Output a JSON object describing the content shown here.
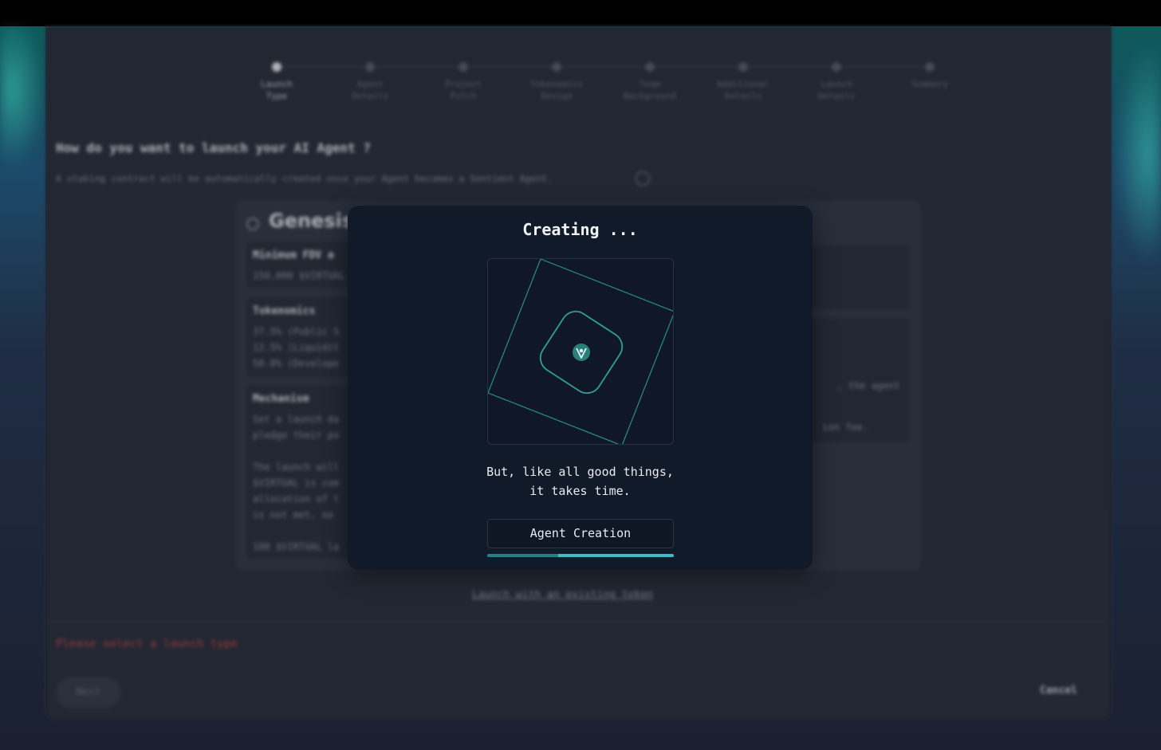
{
  "stepper": {
    "steps": [
      {
        "label": "Launch\nType",
        "active": true
      },
      {
        "label": "Agent\nDetails",
        "active": false
      },
      {
        "label": "Project\nPitch",
        "active": false
      },
      {
        "label": "Tokenomics\nDesign",
        "active": false
      },
      {
        "label": "Team\nBackground",
        "active": false
      },
      {
        "label": "Additional\nDetails",
        "active": false
      },
      {
        "label": "Launch\nDetails",
        "active": false
      },
      {
        "label": "Summary",
        "active": false
      }
    ]
  },
  "question": {
    "title": "How do you want to launch your AI Agent ?",
    "subtitle": "A staking contract will be automatically created once your Agent becomes a Sentient Agent."
  },
  "launch_card": {
    "title": "Genesis",
    "blocks": [
      {
        "heading": "Minimum FDV a",
        "body": "150,000 $VIRTUAL"
      },
      {
        "heading": "Tokenomics",
        "body": "37.5% (Public S\n12.5% (Liquidit\n50.0% (Develope"
      },
      {
        "heading": "Mechanism",
        "body": "Set a launch da\npledge their po\n\nThe launch will\n$VIRTUAL is com\nallocation of t\nis not met, no\n\n100 $VIRTUAL la"
      }
    ],
    "right_snippets": [
      ", the agent",
      "ion fee."
    ]
  },
  "existing_token_link": "Launch with an existing token",
  "error_message": "Please select a launch type",
  "buttons": {
    "next": "Next",
    "cancel": "Cancel"
  },
  "modal": {
    "title": "Creating ...",
    "tagline": "But, like all good things,\nit takes time.",
    "stage": "Agent Creation",
    "progress": {
      "filled_start": 0.38,
      "filled_end": 1.0
    }
  },
  "colors": {
    "accent": "#2a7f87",
    "accent_light": "#45b8c7",
    "modal_bg": "#111a28",
    "error": "#c24a4a"
  },
  "icons": {
    "center": "virtuals-logo-icon"
  }
}
